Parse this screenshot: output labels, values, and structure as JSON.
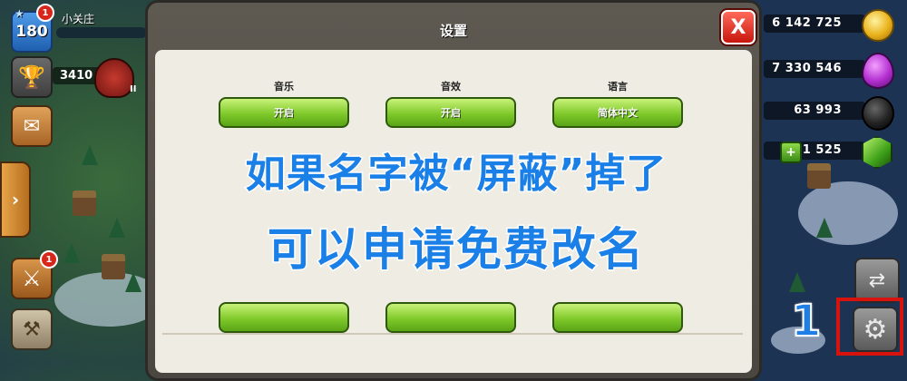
{
  "hud": {
    "level": "180",
    "level_notification": "1",
    "player_name": "小关庄",
    "trophies": "3410",
    "pause_label": "II",
    "attack_notification": "1",
    "expand_arrow": "›",
    "icons": {
      "trophy": "trophy-icon",
      "mail": "mail-icon",
      "battle": "crossed-swords-icon",
      "builder": "builder-icon",
      "swap": "swap-icon",
      "settings": "gear-icon"
    }
  },
  "resources": {
    "gold": "6 142 725",
    "elixir": "7 330 546",
    "dark_elixir": "63 993",
    "gems": "1 525",
    "gem_plus": "+"
  },
  "dialog": {
    "title": "设置",
    "close_label": "X",
    "options": [
      {
        "label": "音乐",
        "button": "开启"
      },
      {
        "label": "音效",
        "button": "开启"
      },
      {
        "label": "语言",
        "button": "简体中文"
      }
    ],
    "bottom_buttons": [
      "",
      "",
      ""
    ]
  },
  "overlay": {
    "line1": "如果名字被“屏蔽”掉了",
    "line2": "可以申请免费改名",
    "step_number": "1"
  },
  "colors": {
    "overlay_text": "#1a7fe6",
    "highlight_box": "#d8120c",
    "button_green": "#7fc92a",
    "close_red": "#c8160d"
  }
}
